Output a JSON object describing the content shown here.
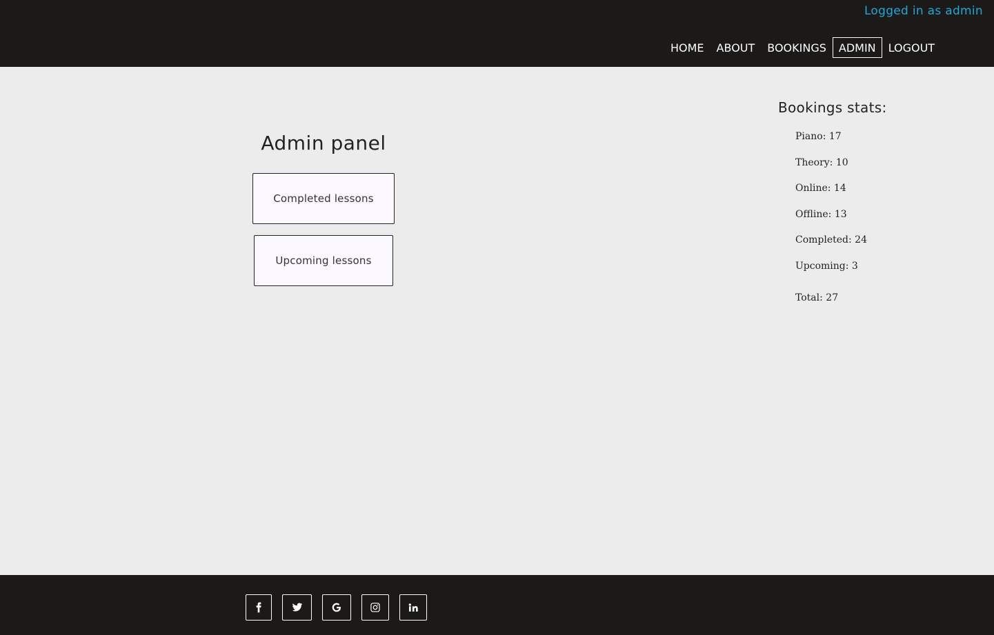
{
  "header": {
    "login_status": "Logged in as admin",
    "nav": [
      {
        "label": "HOME"
      },
      {
        "label": "ABOUT"
      },
      {
        "label": "BOOKINGS"
      },
      {
        "label": "ADMIN",
        "active": true
      },
      {
        "label": "LOGOUT"
      }
    ]
  },
  "main": {
    "title": "Admin panel",
    "buttons": {
      "completed": "Completed lessons",
      "upcoming": "Upcoming lessons"
    }
  },
  "stats": {
    "title": "Bookings stats:",
    "items": [
      "Piano: 17",
      "Theory: 10",
      "Online: 14",
      "Offline: 13",
      "Completed: 24",
      "Upcoming: 3"
    ],
    "total": "Total: 27"
  },
  "footer": {
    "social_icons": [
      "facebook-icon",
      "twitter-icon",
      "google-icon",
      "instagram-icon",
      "linkedin-icon"
    ]
  },
  "colors": {
    "header_bg": "#1b1a19",
    "page_bg": "#ececec",
    "login_text": "#1fa7d6",
    "button_bg": "#fbf8ff"
  }
}
